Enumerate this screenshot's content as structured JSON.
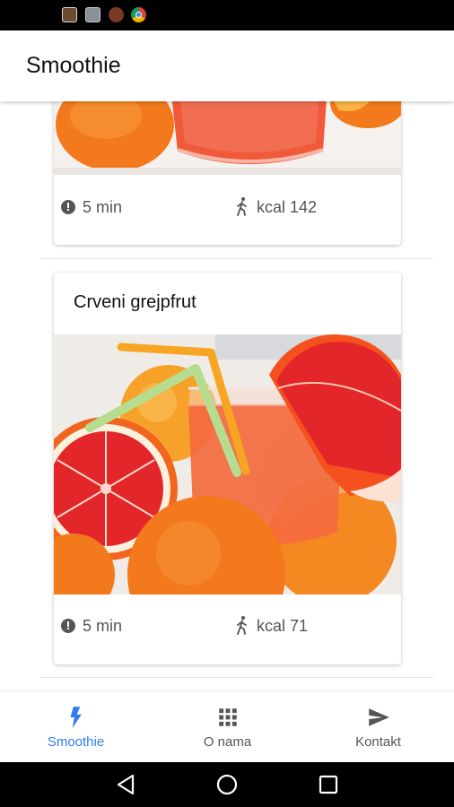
{
  "app": {
    "title": "Smoothie"
  },
  "cards": [
    {
      "title": "",
      "time": "5 min",
      "kcal": "kcal 142"
    },
    {
      "title": "Crveni grejpfrut",
      "time": "5 min",
      "kcal": "kcal 71"
    }
  ],
  "bottom_nav": {
    "items": [
      {
        "label": "Smoothie",
        "icon": "bolt-icon",
        "active": true
      },
      {
        "label": "O nama",
        "icon": "grid-icon",
        "active": false
      },
      {
        "label": "Kontakt",
        "icon": "send-icon",
        "active": false
      }
    ]
  },
  "colors": {
    "accent": "#2f7cf6",
    "text_secondary": "#555555",
    "orange": "#f57c1f",
    "grapefruit": "#e5262a"
  }
}
